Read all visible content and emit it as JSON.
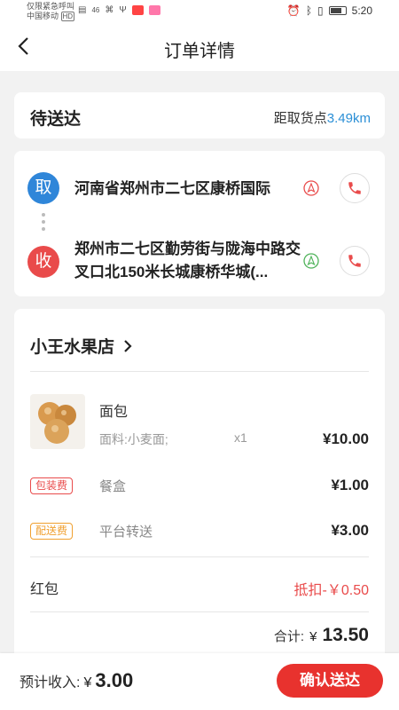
{
  "status_bar": {
    "line1": "仅限紧急呼叫",
    "line2": "中国移动",
    "carrier_badge": "HD",
    "network": "46",
    "time": "5:20"
  },
  "nav": {
    "title": "订单详情",
    "back_icon": "chevron-left-icon"
  },
  "order_status": {
    "status": "待送达",
    "distance_label": "距取货点",
    "distance_value": "3.49km"
  },
  "route": {
    "pickup": {
      "badge": "取",
      "address": "河南省郑州市二七区康桥国际"
    },
    "receive": {
      "badge": "收",
      "address": "郑州市二七区勤劳街与陇海中路交叉口北150米长城康桥华城(..."
    }
  },
  "shop": {
    "name": "小王水果店"
  },
  "product": {
    "name": "面包",
    "spec": "面料:小麦面;",
    "qty": "x1",
    "price": "¥10.00"
  },
  "fees": [
    {
      "tag": "包装费",
      "name": "餐盒",
      "price": "¥1.00"
    },
    {
      "tag": "配送费",
      "name": "平台转送",
      "price": "¥3.00"
    }
  ],
  "red_packet": {
    "label": "红包",
    "value": "抵扣-￥0.50"
  },
  "total": {
    "label": "合计:",
    "currency": "¥",
    "value": "13.50"
  },
  "bottom": {
    "income_label": "预计收入:",
    "income_currency": "¥",
    "income_value": "3.00",
    "confirm_label": "确认送达"
  },
  "colors": {
    "accent_red": "#e8322e",
    "pickup_blue": "#2f86d9",
    "distance_blue": "#2b8fd6",
    "shipping_orange": "#f0a030"
  }
}
